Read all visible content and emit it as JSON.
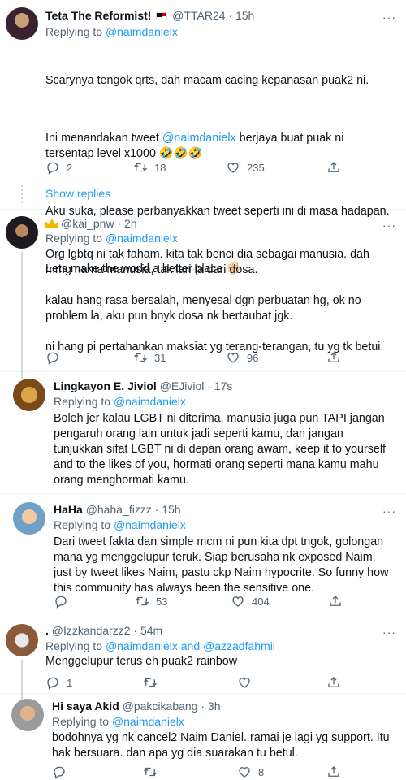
{
  "t1": {
    "name": "Teta The Reformist!",
    "flag_icon": "malaysia-flag-icon",
    "handle": "@TTAR24",
    "time": "15h",
    "reply_prefix": "Replying to ",
    "reply_to": "@naimdanielx",
    "line1": "Scarynya tengok qrts, dah macam cacing kepanasan puak2 ni.",
    "line2a": "Ini menandakan tweet ",
    "line2_mention": "@naimdanielx",
    "line2b": " berjaya buat puak ni tersentap level x1000 🤣🤣🤣",
    "line3": "Aku suka, please perbanyakkan tweet seperti ini di masa hadapan.",
    "line4": "Lets make the world a better place ✊🏻",
    "replies": "2",
    "retweets": "18",
    "likes": "235",
    "show_replies": "Show replies"
  },
  "t2": {
    "handle": "@kai_pnw",
    "time": "2h",
    "reply_prefix": "Replying to ",
    "reply_to": "@naimdanielx",
    "text": "Org lgbtq ni tak faham. kita tak benci dia sebagai manusia. dah mmg nama manusia, tak lari la dari dosa.\n\nkalau hang rasa bersalah, menyesal dgn perbuatan hg, ok no problem la, aku pun bnyk dosa nk bertaubat jgk.\n\nni hang pi pertahankan maksiat yg terang-terangan, tu yg tk betui.",
    "replies": "",
    "retweets": "31",
    "likes": "96"
  },
  "t3": {
    "name": "Lingkayon E. Jiviol",
    "handle": "@EJiviol",
    "time": "17s",
    "reply_prefix": "Replying to ",
    "reply_to": "@naimdanielx",
    "text": "Boleh jer kalau LGBT ni diterima, manusia juga pun TAPI jangan pengaruh orang lain untuk jadi seperti kamu, dan jangan tunjukkan sifat LGBT ni di depan orang awam, keep it to yourself and to the likes of you, hormati orang seperti mana kamu mahu orang menghormati kamu."
  },
  "t4": {
    "name": "HaHa",
    "handle": "@haha_fizzz",
    "time": "15h",
    "reply_prefix": "Replying to ",
    "reply_to": "@naimdanielx",
    "text": "Dari tweet fakta dan simple mcm ni pun kita dpt tngok, golongan mana yg menggelupur teruk. Siap berusaha nk exposed Naim, just by tweet likes Naim, pastu ckp Naim hypocrite. So funny how this community has always been the sensitive one.",
    "replies": "",
    "retweets": "53",
    "likes": "404"
  },
  "t5": {
    "name": ".",
    "handle": "@Izzkandarzz2",
    "time": "54m",
    "reply_prefix": "Replying to ",
    "reply_to": "@naimdanielx",
    "reply_and": " and ",
    "reply_to2": "@azzadfahmii",
    "text": "Menggelupur terus eh puak2 rainbow",
    "replies": "1",
    "retweets": "",
    "likes": ""
  },
  "t6": {
    "name": "Hi saya Akid",
    "handle": "@pakcikabang",
    "time": "3h",
    "reply_prefix": "Replying to ",
    "reply_to": "@naimdanielx",
    "text": "bodohnya yg nk cancel2 Naim Daniel. ramai je lagi yg support. Itu hak bersuara. dan apa yg dia suarakan tu betul.",
    "replies": "",
    "retweets": "",
    "likes": "8"
  },
  "separator": " · ",
  "more": "···"
}
